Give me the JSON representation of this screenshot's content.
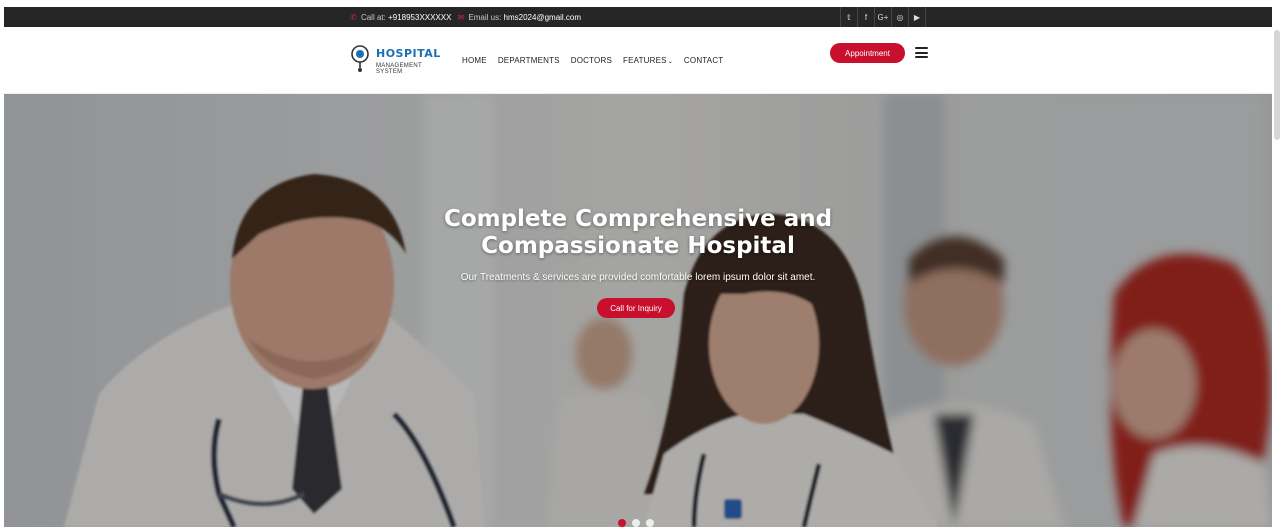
{
  "topbar": {
    "call_label": "Call at:",
    "phone": "+918953XXXXXX",
    "email_label": "Email us:",
    "email": "hms2024@gmail.com",
    "socials": [
      "twitter-icon",
      "facebook-icon",
      "google-plus-icon",
      "instagram-icon",
      "youtube-icon"
    ],
    "social_glyphs": [
      "𝕥",
      "f",
      "G+",
      "◎",
      "▶"
    ]
  },
  "logo": {
    "line1": "HOSPITAL",
    "line2": "MANAGEMENT SYSTEM"
  },
  "nav": {
    "home": "HOME",
    "departments": "DEPARTMENTS",
    "doctors": "DOCTORS",
    "features": "FEATURES",
    "contact": "CONTACT",
    "appointment": "Appointment"
  },
  "hero": {
    "title_line1": "Complete Comprehensive and",
    "title_line2": "Compassionate Hospital",
    "subtitle": "Our Treatments & services are provided comfortable lorem ipsum dolor sit amet.",
    "button": "Call for Inquiry"
  },
  "colors": {
    "accent": "#c8102e",
    "topbar_bg": "#262626",
    "logo_blue": "#1a6fb5"
  }
}
